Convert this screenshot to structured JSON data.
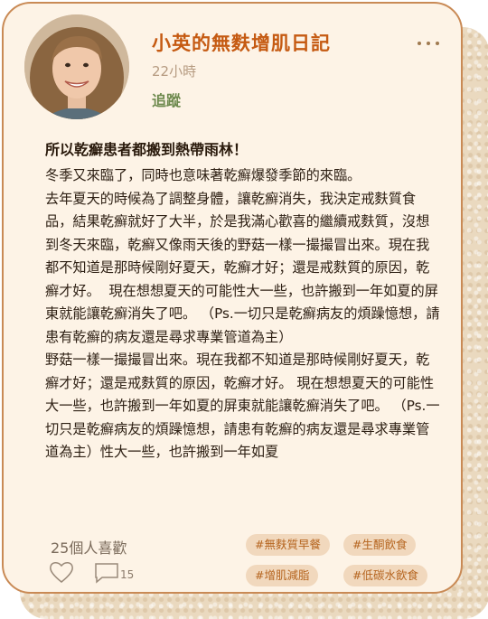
{
  "post": {
    "author": "小英的無麩增肌日記",
    "time": "22小時",
    "follow_label": "追蹤",
    "title": "所以乾癬患者都搬到熱帶雨林！",
    "body": "冬季又來臨了，同時也意味著乾癬爆發季節的來臨。\n去年夏天的時候為了調整身體，讓乾癬消失，我決定戒麩質食品，結果乾癬就好了大半，於是我滿心歡喜的繼續戒麩質，沒想到冬天來臨，乾癬又像雨天後的野菇一樣一撮撮冒出來。現在我都不知道是那時候剛好夏天，乾癬才好；還是戒麩質的原因，乾癬才好。  現在想想夏天的可能性大一些，也許搬到一年如夏的屏東就能讓乾癬消失了吧。 （Ps.一切只是乾癬病友的煩躁憶想，請患有乾癬的病友還是尋求專業管道為主）\n野菇一樣一撮撮冒出來。現在我都不知道是那時候剛好夏天，乾癬才好；還是戒麩質的原因，乾癬才好。 現在想想夏天的可能性大一些，也許搬到一年如夏的屏東就能讓乾癬消失了吧。 （Ps.一切只是乾癬病友的煩躁憶想，請患有乾癬的病友還是尋求專業管道為主）性大一些，也許搬到一年如夏"
  },
  "footer": {
    "likes": "25個人喜歡",
    "comment_count": "15",
    "tags": [
      "#無麩質早餐",
      "#生酮飲食",
      "#增肌減脂",
      "#低碳水飲食"
    ]
  },
  "icons": {
    "more": "more-options-icon",
    "heart": "heart-icon",
    "comment": "comment-icon"
  },
  "colors": {
    "author": "#c55a12",
    "follow": "#6e8a4e",
    "border": "#c98a55",
    "card_bg": "#fdf3e6",
    "tag_bg": "#f1d8bd",
    "tag_text": "#b5641e"
  }
}
